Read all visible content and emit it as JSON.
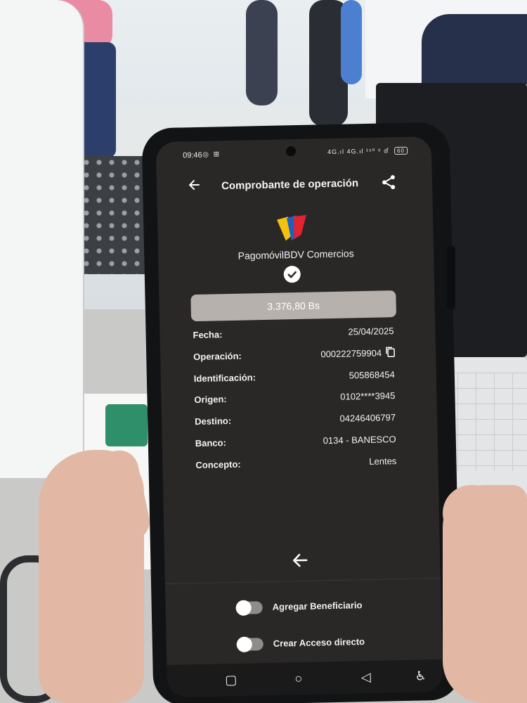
{
  "status_bar": {
    "time": "09:46",
    "left_icons": "◎ ⊞",
    "right_icons": "4G.ıl 4G.ıl ¹⁵⁰ ⁶ ⅆ",
    "battery": "60"
  },
  "app_bar": {
    "title": "Comprobante de operación",
    "back_icon": "arrow-left",
    "share_icon": "share"
  },
  "brand": {
    "name": "PagomóvilBDV Comercios",
    "logo_colors": [
      "#f4c20d",
      "#1f5fbf",
      "#e1252f"
    ]
  },
  "amount": "3.376,80 Bs",
  "details": [
    {
      "label": "Fecha:",
      "value": "25/04/2025"
    },
    {
      "label": "Operación:",
      "value": "000222759904"
    },
    {
      "label": "Identificación:",
      "value": "505868454"
    },
    {
      "label": "Origen:",
      "value": "0102****3945"
    },
    {
      "label": "Destino:",
      "value": "04246406797"
    },
    {
      "label": "Banco:",
      "value": "0134 - BANESCO"
    },
    {
      "label": "Concepto:",
      "value": "Lentes"
    }
  ],
  "toggles": [
    {
      "label": "Agregar Beneficiario",
      "on": false
    },
    {
      "label": "Crear Acceso directo",
      "on": false
    }
  ],
  "nav_bar": {
    "recents": "▢",
    "home": "○",
    "back": "◁",
    "accessibility": "♿"
  }
}
